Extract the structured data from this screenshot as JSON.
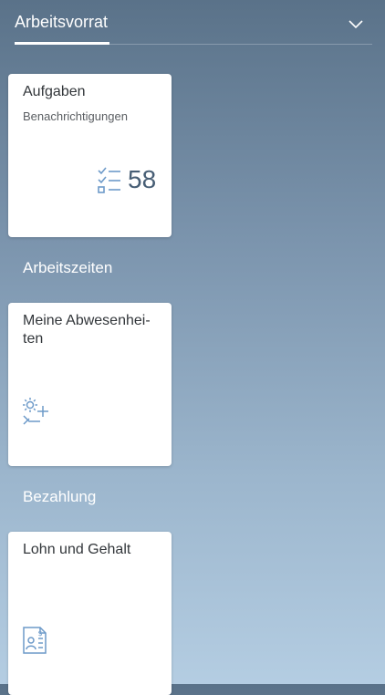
{
  "header": {
    "active_tab": "Arbeitsvorrat"
  },
  "sections": {
    "time": "Arbeitszeiten",
    "pay": "Bezahlung"
  },
  "tiles": {
    "tasks": {
      "title": "Aufgaben",
      "subtitle": "Benachrichtigungen",
      "count": "58",
      "icon": "task-list-icon"
    },
    "absences": {
      "title": "Meine Abwesenhei-\nten",
      "icon": "vacation-add-icon"
    },
    "payroll": {
      "title": "Lohn und Gehalt",
      "icon": "payslip-icon"
    }
  },
  "colors": {
    "icon": "#6d9ac9",
    "count": "#475e75",
    "tile_text": "#32363a"
  }
}
